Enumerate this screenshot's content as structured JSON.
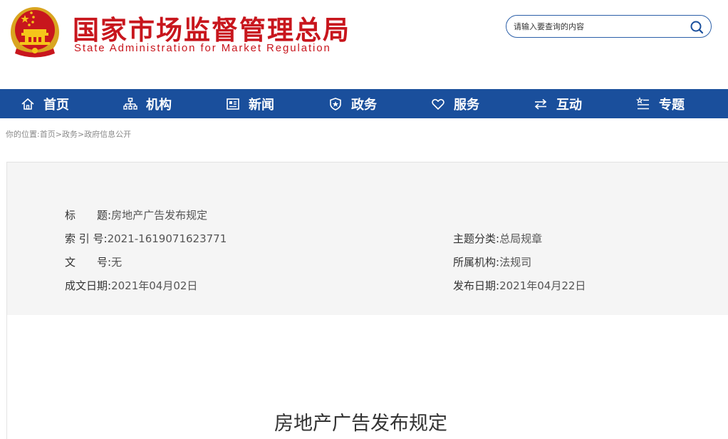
{
  "header": {
    "title": "国家市场监督管理总局",
    "subtitle": "State Administration for Market Regulation",
    "emblem_icon": "national-emblem-icon",
    "colors": {
      "brand_red": "#c8161d",
      "nav_blue": "#1a4f9c"
    }
  },
  "search": {
    "placeholder": "请输入要查询的内容",
    "icon": "search-icon"
  },
  "nav": {
    "items": [
      {
        "label": "首页",
        "icon": "home-icon"
      },
      {
        "label": "机构",
        "icon": "org-chart-icon"
      },
      {
        "label": "新闻",
        "icon": "news-icon"
      },
      {
        "label": "政务",
        "icon": "shield-badge-icon"
      },
      {
        "label": "服务",
        "icon": "heart-icon"
      },
      {
        "label": "互动",
        "icon": "exchange-arrows-icon"
      },
      {
        "label": "专题",
        "icon": "star-list-icon"
      }
    ]
  },
  "breadcrumb": {
    "prefix": "你的位置:",
    "links": [
      "首页",
      "政务",
      "政府信息公开"
    ],
    "separator": ">"
  },
  "info": {
    "title_label": "标　　题:",
    "title_value": "房地产广告发布规定",
    "index_label": "索 引 号:",
    "index_value": "2021-1619071623771",
    "category_label": "主题分类:",
    "category_value": "总局规章",
    "docno_label": "文　　号:",
    "docno_value": "无",
    "org_label": "所属机构:",
    "org_value": "法规司",
    "written_label": "成文日期:",
    "written_value": "2021年04月02日",
    "published_label": "发布日期:",
    "published_value": "2021年04月22日"
  },
  "article": {
    "title": "房地产广告发布规定"
  }
}
